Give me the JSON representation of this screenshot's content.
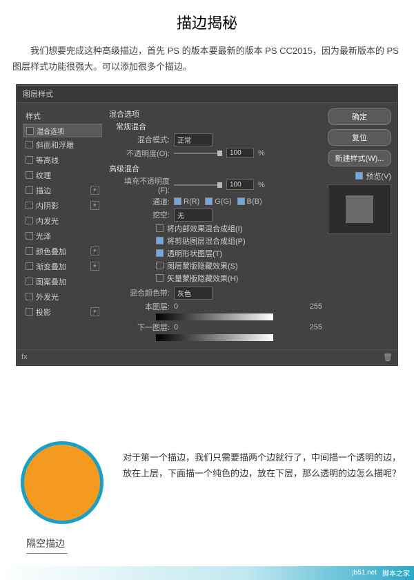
{
  "title": "描边揭秘",
  "lead": "我们想要完成这种高级描边，首先 PS 的版本要最新的版本 PS CC2015，因为最新版本的 PS 图层样式功能很强大。可以添加很多个描边。",
  "dlg": {
    "title": "图层样式"
  },
  "left": {
    "header": "样式",
    "items": [
      {
        "label": "混合选项",
        "sel": true,
        "plus": false
      },
      {
        "label": "斜面和浮雕",
        "plus": false
      },
      {
        "label": "等高线",
        "plus": false
      },
      {
        "label": "纹理",
        "plus": false
      },
      {
        "label": "描边",
        "plus": true
      },
      {
        "label": "内阴影",
        "plus": true
      },
      {
        "label": "内发光",
        "plus": false
      },
      {
        "label": "光泽",
        "plus": false
      },
      {
        "label": "颜色叠加",
        "plus": true
      },
      {
        "label": "渐变叠加",
        "plus": true
      },
      {
        "label": "图案叠加",
        "plus": false
      },
      {
        "label": "外发光",
        "plus": false
      },
      {
        "label": "投影",
        "plus": true
      }
    ]
  },
  "foot": {
    "fx": "fx",
    "trash": "🗑"
  },
  "mid": {
    "section": "混合选项",
    "group": "常规混合",
    "mode": {
      "lab": "混合模式:",
      "val": "正常"
    },
    "opac": {
      "lab": "不透明度(O):",
      "val": "100",
      "unit": "%"
    },
    "adv": "高级混合",
    "fill": {
      "lab": "填充不透明度(F):",
      "val": "100",
      "unit": "%"
    },
    "chan": {
      "lab": "通道:",
      "r": "R(R)",
      "g": "G(G)",
      "b": "B(B)"
    },
    "knock": {
      "lab": "挖空:",
      "val": "无"
    },
    "opts": [
      {
        "on": false,
        "t": "将内部效果混合成组(I)"
      },
      {
        "on": true,
        "t": "将剪贴图层混合成组(P)"
      },
      {
        "on": true,
        "t": "透明形状图层(T)"
      },
      {
        "on": false,
        "t": "图层蒙版隐藏效果(S)"
      },
      {
        "on": false,
        "t": "矢量蒙版隐藏效果(H)"
      }
    ],
    "blendif": {
      "lab": "混合颜色带:",
      "val": "灰色"
    },
    "this": {
      "lab": "本图层:",
      "a": "0",
      "b": "255"
    },
    "under": {
      "lab": "下一图层:",
      "a": "0",
      "b": "255"
    }
  },
  "right": {
    "ok": "确定",
    "cancel": "复位",
    "new": "新建样式(W)...",
    "preview": "预览(V)"
  },
  "sample": {
    "text": "对于第一个描边，我们只需要描两个边就行了，中间描一个透明的边，放在上层，下面描一个纯色的边，放在下层，那么透明的边怎么描呢？",
    "caption": "隔空描边"
  },
  "footer": {
    "site": "jb51.net",
    "brand": "脚本之家"
  }
}
